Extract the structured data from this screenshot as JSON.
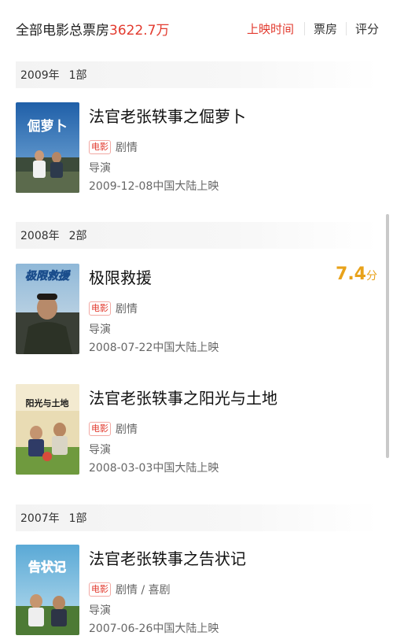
{
  "header": {
    "total_label": "全部电影总票房",
    "total_amount": "3622.7万",
    "tabs": [
      "上映时间",
      "票房",
      "评分"
    ]
  },
  "groups": [
    {
      "year": "2009年",
      "count": "1部",
      "movies": [
        {
          "title": "法官老张轶事之倔萝卜",
          "tag": "电影",
          "genre": "剧情",
          "director": "导演",
          "release": "2009-12-08中国大陆上映",
          "poster_text": "倔萝卜",
          "score": "",
          "score_unit": ""
        }
      ]
    },
    {
      "year": "2008年",
      "count": "2部",
      "movies": [
        {
          "title": "极限救援",
          "tag": "电影",
          "genre": "剧情",
          "director": "导演",
          "release": "2008-07-22中国大陆上映",
          "poster_text": "极限救援",
          "score": "7.4",
          "score_unit": "分"
        },
        {
          "title": "法官老张轶事之阳光与土地",
          "tag": "电影",
          "genre": "剧情",
          "director": "导演",
          "release": "2008-03-03中国大陆上映",
          "poster_text": "阳光与土地",
          "score": "",
          "score_unit": ""
        }
      ]
    },
    {
      "year": "2007年",
      "count": "1部",
      "movies": [
        {
          "title": "法官老张轶事之告状记",
          "tag": "电影",
          "genre": "剧情 / 喜剧",
          "director": "导演",
          "release": "2007-06-26中国大陆上映",
          "poster_text": "告状记",
          "score": "",
          "score_unit": ""
        }
      ]
    }
  ],
  "colors": {
    "accent": "#e23a2e",
    "score": "#e8a21a"
  }
}
